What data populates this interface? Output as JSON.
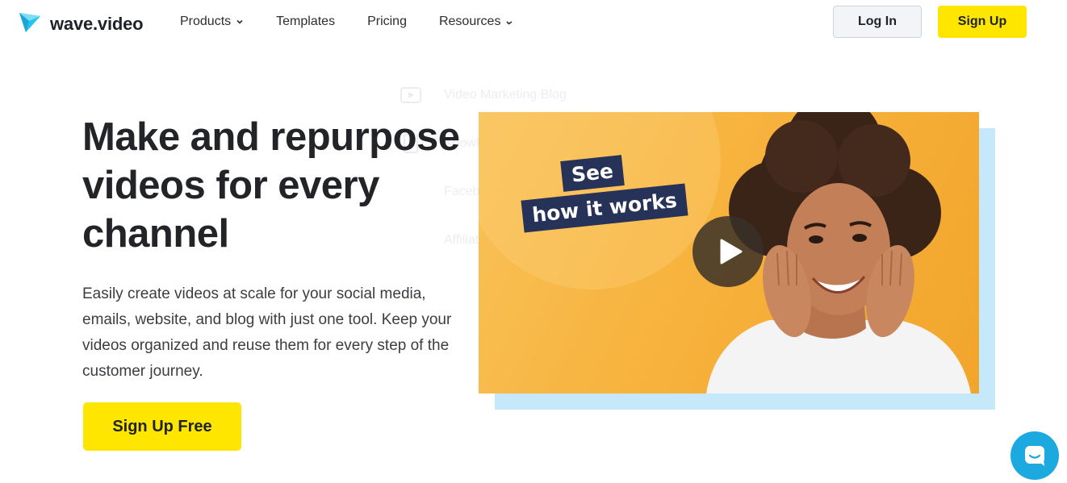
{
  "brand": {
    "name": "wave.video",
    "logo_icon": "wave-video-logo-icon",
    "accent_color": "#ffe600",
    "text_color": "#222428"
  },
  "nav": {
    "items": [
      {
        "label": "Products",
        "has_dropdown": true
      },
      {
        "label": "Templates",
        "has_dropdown": false
      },
      {
        "label": "Pricing",
        "has_dropdown": false
      },
      {
        "label": "Resources",
        "has_dropdown": true
      }
    ]
  },
  "header_actions": {
    "login_label": "Log In",
    "signup_label": "Sign Up"
  },
  "resources_dropdown": {
    "items": [
      {
        "label": "Video Marketing Blog",
        "icon": "play-square-icon"
      },
      {
        "label": "Knowledge Base",
        "icon": "book-icon"
      },
      {
        "label": "Facebook Community",
        "icon": "community-icon"
      },
      {
        "label": "Affiliate Program",
        "icon": "affiliate-icon"
      }
    ]
  },
  "hero": {
    "title": "Make and repurpose videos for every channel",
    "description": "Easily create videos at scale for your social media, emails, website, and blog with just one tool. Keep your videos organized and reuse them for every step of the customer journey.",
    "cta_label": "Sign Up Free"
  },
  "video": {
    "tag_line_1": "See",
    "tag_line_2": "how it works",
    "play_icon": "play-icon",
    "background_color": "#f7b43f",
    "shadow_color": "#c5e8fb"
  },
  "chat_widget": {
    "icon": "chat-bubble-icon",
    "color": "#1ba9e0"
  }
}
